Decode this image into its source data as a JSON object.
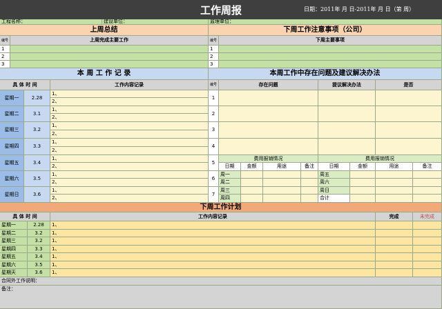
{
  "header": {
    "title": "工作周报",
    "date_label": "日期：2011年 月 日-2011年 月 日（第 周）"
  },
  "project_info": {
    "project_name_label": "工程名称：",
    "construction_unit_label": "建设单位：",
    "supervision_unit_label": "监理单位："
  },
  "last_week": {
    "title": "上周总结",
    "num_header": "编号",
    "main_work_header": "上周完成主要工作",
    "rows": [
      "1",
      "2",
      "3"
    ]
  },
  "next_week_notes": {
    "title": "下周工作注意事项（公司）",
    "num_header": "编号",
    "main_work_header": "下周主要事项",
    "rows": [
      "1",
      "2",
      "3"
    ]
  },
  "this_week": {
    "title": "本 周 工 作 记 录",
    "time_header": "具 体 时 间",
    "content_header": "工作内容记录",
    "days": [
      {
        "day": "星期一",
        "date": "2.28"
      },
      {
        "day": "星期二",
        "date": "3.1"
      },
      {
        "day": "星期三",
        "date": "3.2"
      },
      {
        "day": "星期四",
        "date": "3.3"
      },
      {
        "day": "星期五",
        "date": "3.4"
      },
      {
        "day": "星期六",
        "date": "3.5"
      },
      {
        "day": "星期日",
        "date": "3.6"
      }
    ],
    "line1": "1、",
    "line2": "2、"
  },
  "problems": {
    "title": "本周工作中存在问题及建议解决办法",
    "num_header": "编号",
    "problem_header": "存在问题",
    "solution_header": "提议解决办法",
    "yesno_header": "是否",
    "rows": [
      "1",
      "2",
      "3",
      "4",
      "5",
      "6",
      "7"
    ]
  },
  "expense": {
    "title": "费用报销情况",
    "col_date": "日期",
    "col_amount": "金额",
    "col_use": "用途",
    "col_note": "备注",
    "left_days": [
      "周一",
      "周二",
      "周三",
      "周四"
    ],
    "right_days": [
      "周五",
      "周六",
      "周日",
      "合计"
    ]
  },
  "next_week_plan": {
    "title": "下周工作计划",
    "time_header": "具 体 时 间",
    "content_header": "工作内容记录",
    "done_header": "完成",
    "undone_header": "未完成",
    "days": [
      {
        "day": "星期一",
        "date": "2.28"
      },
      {
        "day": "星期二",
        "date": "3.2"
      },
      {
        "day": "星期三",
        "date": "3.2"
      },
      {
        "day": "星期四",
        "date": "3.3"
      },
      {
        "day": "星期五",
        "date": "3.4"
      },
      {
        "day": "星期六",
        "date": "3.5"
      },
      {
        "day": "星期天",
        "date": "3.6"
      }
    ],
    "line": "1、"
  },
  "footer": {
    "extra_work_label": "合同外工作说明：",
    "remark_label": "备注："
  },
  "colors": {
    "header_bg": "#3f3f3f",
    "green": "#c4e0a4",
    "peach": "#fbd3b0",
    "orange": "#f2a97a",
    "blue": "#9bbce6",
    "cream": "#fdf5cf",
    "yellow": "#fde6a2"
  }
}
